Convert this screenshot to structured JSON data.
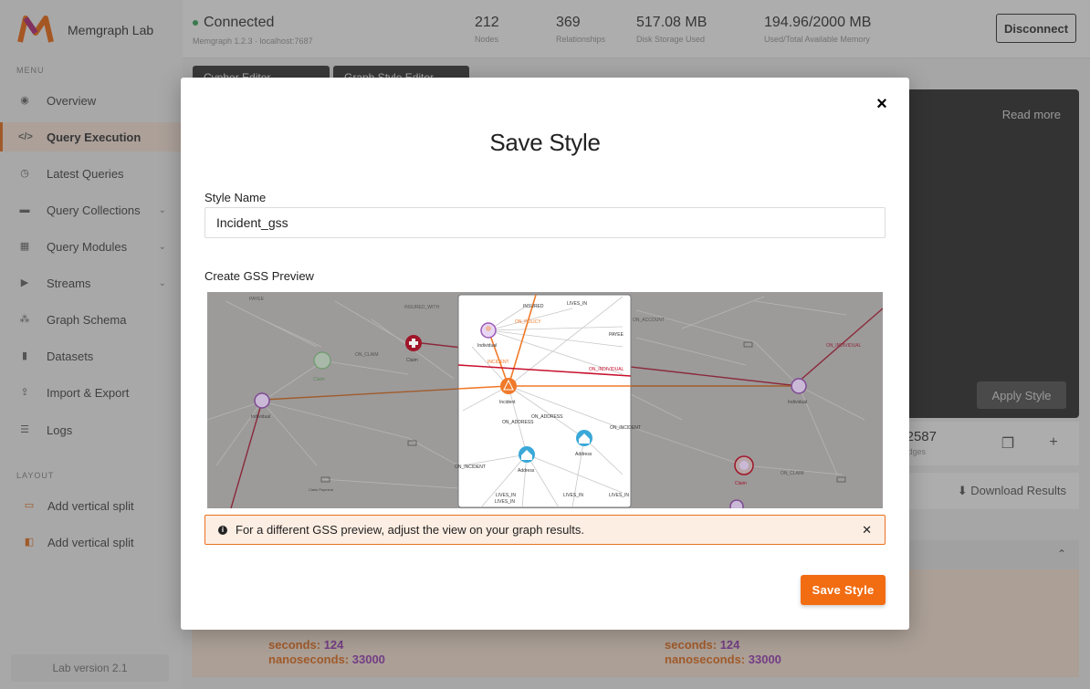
{
  "app": {
    "brand": "Memgraph Lab",
    "menu_caption": "MENU",
    "layout_caption": "LAYOUT",
    "lab_version": "Lab version 2.1"
  },
  "sidebar": {
    "items": [
      {
        "label": "Overview",
        "icon": "eye-icon"
      },
      {
        "label": "Query Execution",
        "icon": "code-icon"
      },
      {
        "label": "Latest Queries",
        "icon": "history-icon"
      },
      {
        "label": "Query Collections",
        "icon": "folder-icon"
      },
      {
        "label": "Query Modules",
        "icon": "modules-icon"
      },
      {
        "label": "Streams",
        "icon": "play-icon"
      },
      {
        "label": "Graph Schema",
        "icon": "schema-icon"
      },
      {
        "label": "Datasets",
        "icon": "database-icon"
      },
      {
        "label": "Import & Export",
        "icon": "upload-icon"
      },
      {
        "label": "Logs",
        "icon": "logs-icon"
      }
    ],
    "layout_items": [
      {
        "label": "Add vertical split"
      },
      {
        "label": "Add vertical split"
      }
    ]
  },
  "topbar": {
    "status": "Connected",
    "sub": "Memgraph 1.2.3 · localhost:7687",
    "stats": [
      {
        "value": "212",
        "label": "Nodes"
      },
      {
        "value": "369",
        "label": "Relationships"
      },
      {
        "value": "517.08 MB",
        "label": "Disk Storage Used"
      },
      {
        "value": "194.96/2000 MB",
        "label": "Used/Total Available Memory"
      }
    ],
    "disconnect_label": "Disconnect"
  },
  "editor": {
    "tabs": [
      "Cypher Editor",
      "Graph Style Editor"
    ],
    "read_more": "Read more",
    "apply_style": "Apply Style"
  },
  "results": {
    "edges_value": "2587",
    "edges_label": "Edges",
    "download": "Download Results",
    "seconds_label": "seconds:",
    "seconds_value": "124",
    "nanos_label": "nanoseconds:",
    "nanos_value": "33000"
  },
  "modal": {
    "title": "Save Style",
    "style_name_label": "Style Name",
    "style_name_value": "Incident_gss",
    "preview_label": "Create GSS Preview",
    "alert_text": "For a different GSS preview, adjust the view on your graph results.",
    "save_button": "Save Style",
    "close_icon": "×"
  },
  "graph_preview": {
    "node_labels": [
      "Individual",
      "Incident",
      "Address",
      "Address",
      "Claim",
      "Individual",
      "Individual",
      "Claim",
      "Claim Payment",
      "Individual"
    ],
    "edge_labels": [
      "INSURED",
      "LIVES_IN",
      "ON_POLICY",
      "PAYEE",
      "INCIDENT",
      "ON_INDIVIDUAL",
      "ON_ADDRESS",
      "ON_ADDRESS",
      "ON_INCIDENT",
      "ON_INCIDENT",
      "LIVES_IN",
      "LIVES_IN",
      "LIVES_IN",
      "LIVES_IN",
      "ON_CLAIM",
      "ON_CLAIM",
      "PAYEE",
      "ON_INDIVIDUAL",
      "INSURED_WITH",
      "ON_ACCOUNT"
    ],
    "colors": {
      "incident": "#f07a2a",
      "claim_red": "#c8102e",
      "individual": "#9b59b6",
      "address": "#3aa8d8",
      "claim_green": "#5bb85d"
    }
  }
}
